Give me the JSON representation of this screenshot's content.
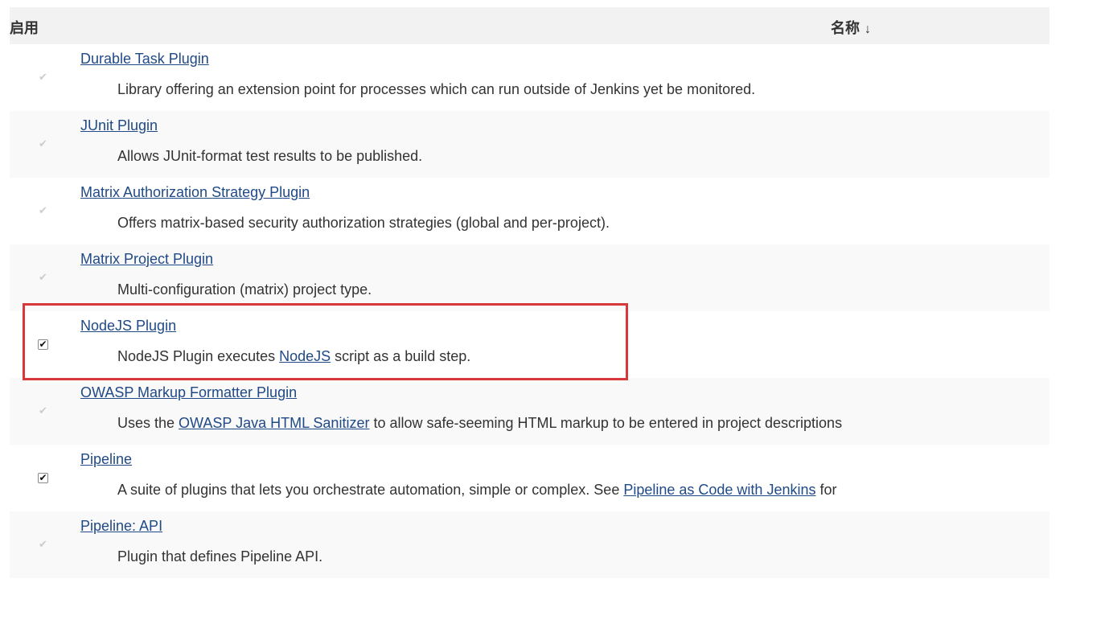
{
  "header": {
    "enabled_label": "启用",
    "name_label": "名称",
    "sort_indicator": "↓"
  },
  "plugins": [
    {
      "title": "Durable Task Plugin",
      "enabled": true,
      "editable": false,
      "desc_before": "Library offering an extension point for processes which can run outside of Jenkins yet be monitored.",
      "link": "",
      "desc_after": ""
    },
    {
      "title": "JUnit Plugin",
      "enabled": true,
      "editable": false,
      "desc_before": "Allows JUnit-format test results to be published.",
      "link": "",
      "desc_after": ""
    },
    {
      "title": "Matrix Authorization Strategy Plugin",
      "enabled": true,
      "editable": false,
      "desc_before": "Offers matrix-based security authorization strategies (global and per-project).",
      "link": "",
      "desc_after": ""
    },
    {
      "title": "Matrix Project Plugin",
      "enabled": true,
      "editable": false,
      "desc_before": "Multi-configuration (matrix) project type.",
      "link": "",
      "desc_after": ""
    },
    {
      "title": "NodeJS Plugin",
      "enabled": true,
      "editable": true,
      "desc_before": "NodeJS Plugin executes ",
      "link": "NodeJS",
      "desc_after": " script as a build step."
    },
    {
      "title": "OWASP Markup Formatter Plugin",
      "enabled": true,
      "editable": false,
      "desc_before": "Uses the ",
      "link": "OWASP Java HTML Sanitizer",
      "desc_after": " to allow safe-seeming HTML markup to be entered in project descriptions"
    },
    {
      "title": "Pipeline",
      "enabled": true,
      "editable": true,
      "desc_before": "A suite of plugins that lets you orchestrate automation, simple or complex. See ",
      "link": "Pipeline as Code with Jenkins",
      "desc_after": " for"
    },
    {
      "title": "Pipeline: API",
      "enabled": true,
      "editable": false,
      "desc_before": "Plugin that defines Pipeline API.",
      "link": "",
      "desc_after": ""
    }
  ],
  "highlight_color": "#d9383a",
  "link_color": "#204a87",
  "icons": {
    "enabled_check": "checkmark-icon"
  }
}
